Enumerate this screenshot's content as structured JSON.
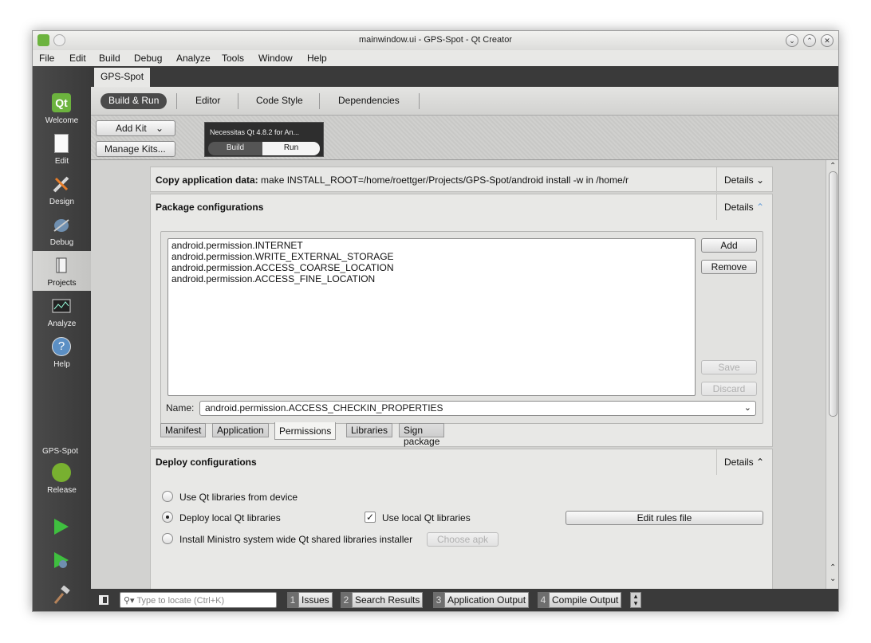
{
  "window": {
    "title": "mainwindow.ui - GPS-Spot - Qt Creator"
  },
  "menu": [
    "File",
    "Edit",
    "Build",
    "Debug",
    "Analyze",
    "Tools",
    "Window",
    "Help"
  ],
  "modes": {
    "welcome": "Welcome",
    "edit": "Edit",
    "design": "Design",
    "debug": "Debug",
    "projects": "Projects",
    "analyze": "Analyze",
    "help": "Help",
    "project_name": "GPS-Spot",
    "build_config": "Release"
  },
  "project_tab": "GPS-Spot",
  "subtabs": {
    "build_run": "Build & Run",
    "editor": "Editor",
    "code_style": "Code Style",
    "dependencies": "Dependencies"
  },
  "kits": {
    "add_kit": "Add Kit",
    "manage_kits": "Manage Kits...",
    "kit_name": "Necessitas Qt 4.8.2 for An...",
    "build": "Build",
    "run": "Run"
  },
  "copy_step": {
    "label": "Copy application data:",
    "command": " make INSTALL_ROOT=/home/roettger/Projects/GPS-Spot/android install -w in /home/r",
    "details": "Details"
  },
  "package": {
    "title": "Package configurations",
    "details": "Details",
    "permissions": [
      "android.permission.INTERNET",
      "android.permission.WRITE_EXTERNAL_STORAGE",
      "android.permission.ACCESS_COARSE_LOCATION",
      "android.permission.ACCESS_FINE_LOCATION"
    ],
    "add": "Add",
    "remove": "Remove",
    "save": "Save",
    "discard": "Discard",
    "name_label": "Name:",
    "name_value": "android.permission.ACCESS_CHECKIN_PROPERTIES",
    "tabs": [
      "Manifest",
      "Application",
      "Permissions",
      "Libraries",
      "Sign package"
    ]
  },
  "deploy": {
    "title": "Deploy configurations",
    "details": "Details",
    "opt_device": "Use Qt libraries from device",
    "opt_local": "Deploy local Qt libraries",
    "use_local": "Use local Qt libraries",
    "edit_rules": "Edit rules file",
    "opt_ministro": "Install Ministro system wide Qt shared libraries installer",
    "choose_apk": "Choose apk"
  },
  "status": {
    "locate_placeholder": "Type to locate (Ctrl+K)",
    "panes": [
      {
        "num": "1",
        "label": "Issues"
      },
      {
        "num": "2",
        "label": "Search Results"
      },
      {
        "num": "3",
        "label": "Application Output"
      },
      {
        "num": "4",
        "label": "Compile Output"
      }
    ]
  }
}
